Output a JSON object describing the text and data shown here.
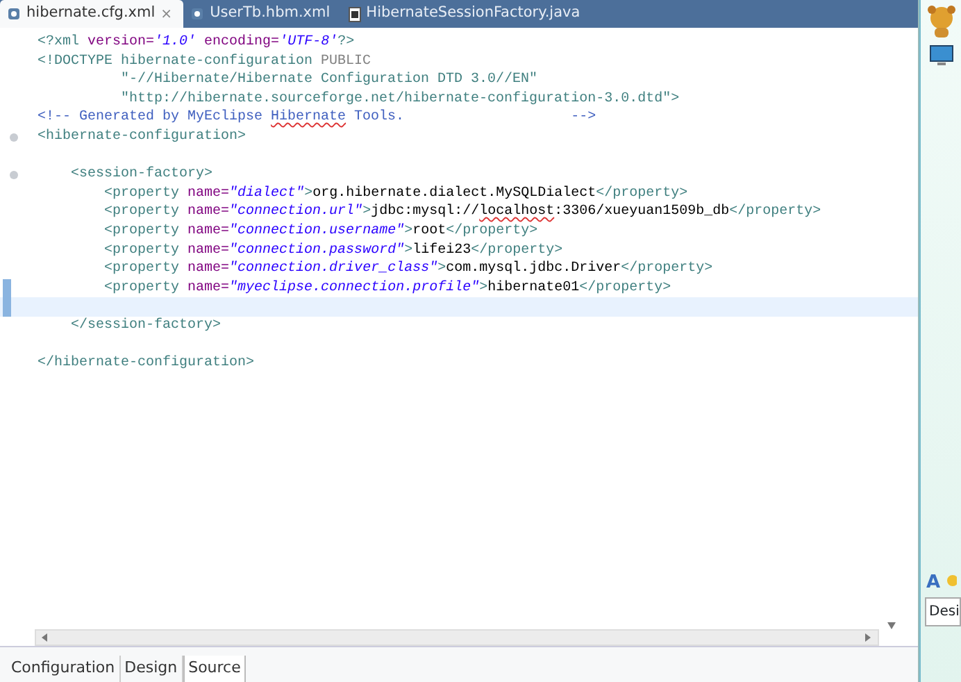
{
  "tabs": [
    {
      "label": "hibernate.cfg.xml",
      "close": "×",
      "selected": true,
      "kind": "xml"
    },
    {
      "label": "UserTb.hbm.xml",
      "selected": false,
      "kind": "xml"
    },
    {
      "label": "HibernateSessionFactory.java",
      "selected": false,
      "kind": "java"
    }
  ],
  "code_lines": [
    {
      "kind": "code",
      "tokens": [
        {
          "kind": "tag",
          "text": "<?xml "
        },
        {
          "kind": "attr",
          "text": "version="
        },
        {
          "kind": "value",
          "text": "'1.0'"
        },
        {
          "kind": "attr",
          "text": " encoding="
        },
        {
          "kind": "value",
          "text": "'UTF-8'"
        },
        {
          "kind": "tag",
          "text": "?>"
        }
      ]
    },
    {
      "kind": "code",
      "tokens": [
        {
          "kind": "tag",
          "text": "<!DOCTYPE hibernate-configuration "
        },
        {
          "kind": "doctype",
          "text": "PUBLIC"
        }
      ]
    },
    {
      "kind": "code",
      "tokens": [
        {
          "kind": "tag",
          "text": "          \"-//Hibernate/Hibernate Configuration DTD 3.0//EN\""
        }
      ]
    },
    {
      "kind": "code",
      "tokens": [
        {
          "kind": "tag",
          "text": "          \"http://hibernate.sourceforge.net/hibernate-configuration-3.0.dtd\">"
        }
      ]
    },
    {
      "kind": "code",
      "tokens": [
        {
          "kind": "comment",
          "text": "<!-- Generated by MyEclipse "
        },
        {
          "kind": "typo",
          "text": "Hibernate"
        },
        {
          "kind": "comment",
          "text": " Tools.                    -->"
        }
      ]
    },
    {
      "kind": "code",
      "fold": true,
      "tokens": [
        {
          "kind": "tag",
          "text": "<hibernate-configuration>"
        }
      ]
    },
    {
      "kind": "blank"
    },
    {
      "kind": "code",
      "fold": true,
      "tokens": [
        {
          "kind": "tag",
          "text": "    <session-factory>"
        }
      ]
    },
    {
      "kind": "code",
      "tokens": [
        {
          "kind": "tag",
          "text": "        <property "
        },
        {
          "kind": "attr",
          "text": "name="
        },
        {
          "kind": "value",
          "text": "\"dialect\""
        },
        {
          "kind": "tag",
          "text": ">"
        },
        {
          "kind": "text",
          "text": "org.hibernate.dialect.MySQLDialect"
        },
        {
          "kind": "tag",
          "text": "</property>"
        }
      ]
    },
    {
      "kind": "code",
      "tokens": [
        {
          "kind": "tag",
          "text": "        <property "
        },
        {
          "kind": "attr",
          "text": "name="
        },
        {
          "kind": "value",
          "text": "\"connection.url\""
        },
        {
          "kind": "tag",
          "text": ">"
        },
        {
          "kind": "text",
          "text": "jdbc:mysql://"
        },
        {
          "kind": "typo-text",
          "text": "localhost"
        },
        {
          "kind": "text",
          "text": ":3306/xueyuan1509b_db"
        },
        {
          "kind": "tag",
          "text": "</property>"
        }
      ]
    },
    {
      "kind": "code",
      "tokens": [
        {
          "kind": "tag",
          "text": "        <property "
        },
        {
          "kind": "attr",
          "text": "name="
        },
        {
          "kind": "value",
          "text": "\"connection.username\""
        },
        {
          "kind": "tag",
          "text": ">"
        },
        {
          "kind": "text",
          "text": "root"
        },
        {
          "kind": "tag",
          "text": "</property>"
        }
      ]
    },
    {
      "kind": "code",
      "tokens": [
        {
          "kind": "tag",
          "text": "        <property "
        },
        {
          "kind": "attr",
          "text": "name="
        },
        {
          "kind": "value",
          "text": "\"connection.password\""
        },
        {
          "kind": "tag",
          "text": ">"
        },
        {
          "kind": "text",
          "text": "lifei23"
        },
        {
          "kind": "tag",
          "text": "</property>"
        }
      ]
    },
    {
      "kind": "code",
      "tokens": [
        {
          "kind": "tag",
          "text": "        <property "
        },
        {
          "kind": "attr",
          "text": "name="
        },
        {
          "kind": "value",
          "text": "\"connection.driver_class\""
        },
        {
          "kind": "tag",
          "text": ">"
        },
        {
          "kind": "text",
          "text": "com.mysql.jdbc.Driver"
        },
        {
          "kind": "tag",
          "text": "</property>"
        }
      ]
    },
    {
      "kind": "code",
      "changed": true,
      "tokens": [
        {
          "kind": "tag",
          "text": "        <property "
        },
        {
          "kind": "attr",
          "text": "name="
        },
        {
          "kind": "value",
          "text": "\"myeclipse.connection.profile\""
        },
        {
          "kind": "tag",
          "text": ">"
        },
        {
          "kind": "text",
          "text": "hibernate01"
        },
        {
          "kind": "tag",
          "text": "</property>"
        }
      ]
    },
    {
      "kind": "blank",
      "changed": true,
      "current": true
    },
    {
      "kind": "code",
      "tokens": [
        {
          "kind": "tag",
          "text": "    </session-factory>"
        }
      ]
    },
    {
      "kind": "blank"
    },
    {
      "kind": "code",
      "tokens": [
        {
          "kind": "tag",
          "text": "</hibernate-configuration>"
        }
      ]
    }
  ],
  "bottom_tabs": [
    {
      "label": "Configuration",
      "selected": false
    },
    {
      "label": "Design",
      "selected": false
    },
    {
      "label": "Source",
      "selected": true
    }
  ],
  "side_panel": {
    "font_glyph": "A",
    "tab_label": "Desi"
  }
}
